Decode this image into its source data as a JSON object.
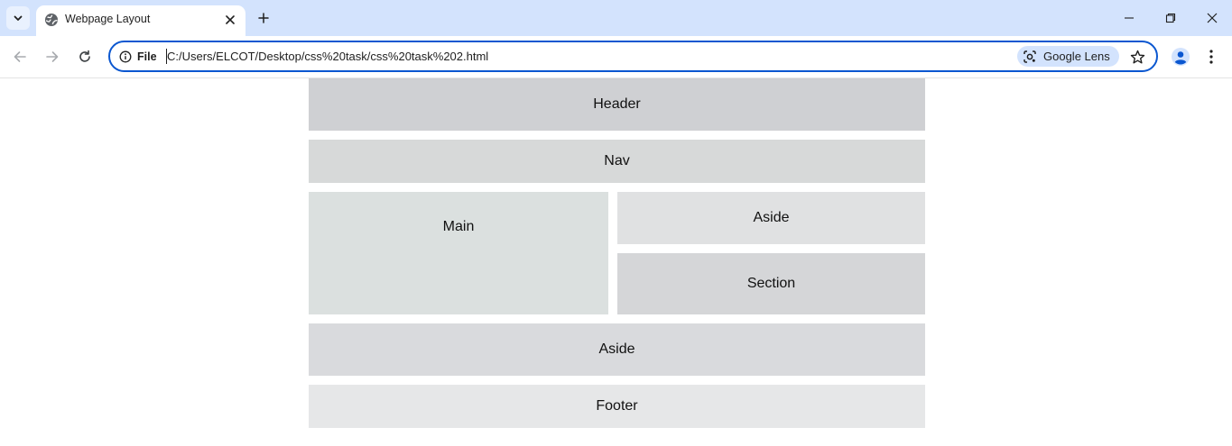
{
  "browser": {
    "tab": {
      "title": "Webpage Layout"
    },
    "omnibox": {
      "site_label": "File",
      "url": "C:/Users/ELCOT/Desktop/css%20task/css%20task%202.html",
      "lens_label": "Google Lens"
    }
  },
  "page": {
    "header": "Header",
    "nav": "Nav",
    "main": "Main",
    "aside_top": "Aside",
    "section": "Section",
    "aside_bottom": "Aside",
    "footer": "Footer"
  }
}
